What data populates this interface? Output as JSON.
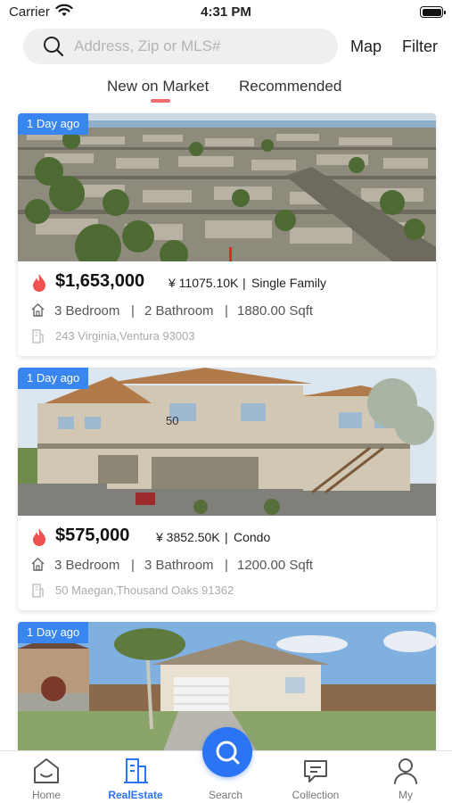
{
  "status_bar": {
    "carrier": "Carrier",
    "time": "4:31 PM"
  },
  "search": {
    "placeholder": "Address, Zip or MLS#",
    "map_label": "Map",
    "filter_label": "Filter"
  },
  "tabs": [
    {
      "label": "New on Market",
      "active": true
    },
    {
      "label": "Recommended",
      "active": false
    }
  ],
  "colors": {
    "accent": "#2b74f3",
    "badge": "#3a86f0",
    "tab_indicator": "#f06b6b",
    "flame": "#f0524f"
  },
  "listings": [
    {
      "badge": "1 Day ago",
      "price": "$1,653,000",
      "price_cny": "¥ 11075.10K",
      "type": "Single Family",
      "bedrooms": "3 Bedroom",
      "bathrooms": "2 Bathroom",
      "area": "1880.00 Sqft",
      "address": "243 Virginia,Ventura 93003"
    },
    {
      "badge": "1 Day ago",
      "price": "$575,000",
      "price_cny": "¥ 3852.50K",
      "type": "Condo",
      "bedrooms": "3 Bedroom",
      "bathrooms": "3 Bathroom",
      "area": "1200.00 Sqft",
      "address": "50 Maegan,Thousand Oaks 91362"
    },
    {
      "badge": "1 Day ago"
    }
  ],
  "tab_bar": [
    {
      "label": "Home",
      "icon": "home-icon",
      "active": false
    },
    {
      "label": "RealEstate",
      "icon": "building-icon",
      "active": true
    },
    {
      "label": "Search",
      "icon": "search-icon",
      "active": false
    },
    {
      "label": "Collection",
      "icon": "chat-icon",
      "active": false
    },
    {
      "label": "My",
      "icon": "person-icon",
      "active": false
    }
  ]
}
